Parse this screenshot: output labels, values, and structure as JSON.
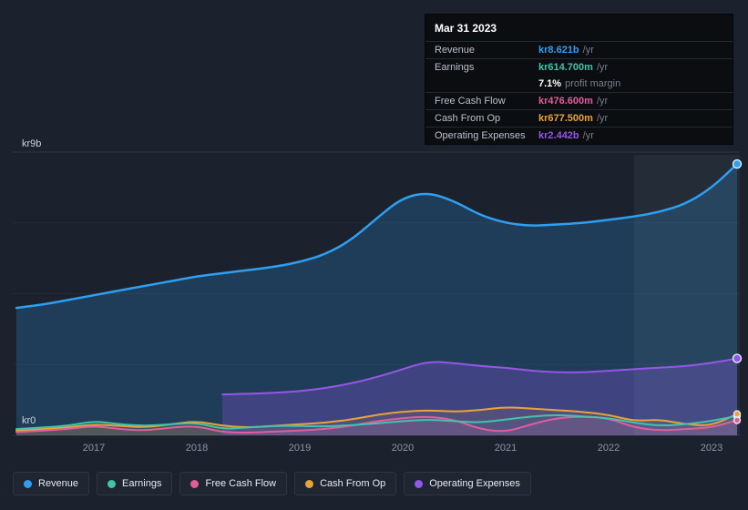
{
  "tooltip": {
    "date": "Mar 31 2023",
    "rows": [
      {
        "label": "Revenue",
        "value": "kr8.621b",
        "suffix": "/yr",
        "color": "#2f9ff2"
      },
      {
        "label": "Earnings",
        "value": "kr614.700m",
        "suffix": "/yr",
        "color": "#41c3ac"
      },
      {
        "label": "Free Cash Flow",
        "value": "kr476.600m",
        "suffix": "/yr",
        "color": "#e15d9d"
      },
      {
        "label": "Cash From Op",
        "value": "kr677.500m",
        "suffix": "/yr",
        "color": "#e7a43b"
      },
      {
        "label": "Operating Expenses",
        "value": "kr2.442b",
        "suffix": "/yr",
        "color": "#9557e8"
      }
    ],
    "profit_margin": {
      "value": "7.1%",
      "label": "profit margin"
    }
  },
  "axes": {
    "y_top_label": "kr9b",
    "y_bottom_label": "kr0",
    "x_ticks": [
      "2017",
      "2018",
      "2019",
      "2020",
      "2021",
      "2022",
      "2023"
    ]
  },
  "legend": {
    "items": [
      {
        "label": "Revenue",
        "color": "#2f9ff2"
      },
      {
        "label": "Earnings",
        "color": "#41c3ac"
      },
      {
        "label": "Free Cash Flow",
        "color": "#e15d9d"
      },
      {
        "label": "Cash From Op",
        "color": "#e7a43b"
      },
      {
        "label": "Operating Expenses",
        "color": "#9557e8"
      }
    ]
  },
  "chart_data": {
    "type": "line",
    "title": "",
    "x_unit": "year",
    "y_unit": "kr (billions)",
    "x_range": [
      2016.25,
      2023.3
    ],
    "y_range": [
      0,
      9
    ],
    "gridlines": [
      0,
      2.25,
      4.5,
      6.75,
      9
    ],
    "highlight_band": [
      2022.25,
      2023.3
    ],
    "x": [
      2016.25,
      2016.5,
      2016.75,
      2017,
      2017.25,
      2017.5,
      2017.75,
      2018,
      2018.25,
      2018.5,
      2018.75,
      2019,
      2019.25,
      2019.5,
      2019.75,
      2020,
      2020.25,
      2020.5,
      2020.75,
      2021,
      2021.25,
      2021.5,
      2021.75,
      2022,
      2022.25,
      2022.5,
      2022.75,
      2023,
      2023.25
    ],
    "series": [
      {
        "name": "Revenue",
        "color": "#2f9ff2",
        "fill_opacity": 0.22,
        "values": [
          4.05,
          4.15,
          4.3,
          4.45,
          4.6,
          4.75,
          4.9,
          5.05,
          5.15,
          5.25,
          5.35,
          5.5,
          5.75,
          6.2,
          6.9,
          7.55,
          7.72,
          7.45,
          7.0,
          6.75,
          6.65,
          6.7,
          6.75,
          6.85,
          6.95,
          7.1,
          7.35,
          7.85,
          8.621
        ]
      },
      {
        "name": "Earnings",
        "color": "#41c3ac",
        "fill_opacity": 0.08,
        "values": [
          0.2,
          0.25,
          0.3,
          0.45,
          0.35,
          0.3,
          0.35,
          0.4,
          0.2,
          0.25,
          0.3,
          0.3,
          0.28,
          0.32,
          0.38,
          0.45,
          0.5,
          0.45,
          0.4,
          0.5,
          0.6,
          0.65,
          0.6,
          0.55,
          0.4,
          0.3,
          0.35,
          0.45,
          0.615
        ]
      },
      {
        "name": "Free Cash Flow",
        "color": "#e15d9d",
        "fill_opacity": 0.12,
        "values": [
          0.1,
          0.15,
          0.2,
          0.3,
          0.2,
          0.15,
          0.25,
          0.3,
          0.1,
          0.08,
          0.12,
          0.15,
          0.2,
          0.3,
          0.45,
          0.55,
          0.6,
          0.5,
          0.2,
          0.1,
          0.35,
          0.55,
          0.6,
          0.55,
          0.25,
          0.15,
          0.2,
          0.25,
          0.477
        ]
      },
      {
        "name": "Cash From Op",
        "color": "#e7a43b",
        "fill_opacity": 0.15,
        "values": [
          0.15,
          0.2,
          0.25,
          0.35,
          0.3,
          0.25,
          0.35,
          0.45,
          0.3,
          0.25,
          0.3,
          0.35,
          0.4,
          0.5,
          0.65,
          0.75,
          0.8,
          0.75,
          0.8,
          0.9,
          0.85,
          0.8,
          0.75,
          0.65,
          0.45,
          0.5,
          0.35,
          0.3,
          0.678
        ]
      },
      {
        "name": "Operating Expenses",
        "color": "#9557e8",
        "fill_opacity": 0.28,
        "values": [
          null,
          null,
          null,
          null,
          null,
          null,
          null,
          null,
          1.3,
          1.32,
          1.35,
          1.4,
          1.5,
          1.65,
          1.85,
          2.1,
          2.35,
          2.3,
          2.2,
          2.15,
          2.05,
          2.0,
          2.0,
          2.05,
          2.1,
          2.15,
          2.2,
          2.3,
          2.442
        ]
      }
    ],
    "legend_position": "bottom"
  }
}
